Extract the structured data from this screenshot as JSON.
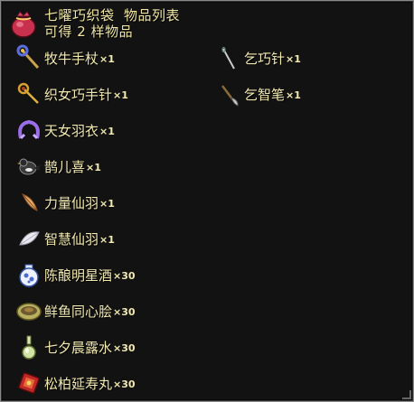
{
  "header": {
    "title": "七曜巧织袋  物品列表",
    "subtitle": "可得 2 样物品",
    "icon": "red-pouch-icon"
  },
  "left_items": [
    {
      "name": "牧牛手杖",
      "qty": "×1",
      "icon": "blue-staff-icon"
    },
    {
      "name": "织女巧手针",
      "qty": "×1",
      "icon": "golden-needle-icon"
    },
    {
      "name": "天女羽衣",
      "qty": "×1",
      "icon": "purple-ribbon-icon"
    },
    {
      "name": "鹊儿喜",
      "qty": "×1",
      "icon": "magpie-icon"
    },
    {
      "name": "力量仙羽",
      "qty": "×1",
      "icon": "orange-feather-icon"
    },
    {
      "name": "智慧仙羽",
      "qty": "×1",
      "icon": "white-feather-icon"
    },
    {
      "name": "陈酿明星酒",
      "qty": "×30",
      "icon": "porcelain-jar-icon"
    },
    {
      "name": "鲜鱼同心脍",
      "qty": "×30",
      "icon": "fish-dish-icon"
    },
    {
      "name": "七夕晨露水",
      "qty": "×30",
      "icon": "green-vase-icon"
    },
    {
      "name": "松柏延寿丸",
      "qty": "×30",
      "icon": "red-pill-box-icon"
    }
  ],
  "right_items": [
    {
      "name": "乞巧针",
      "qty": "×1",
      "icon": "needle-icon"
    },
    {
      "name": "乞智笔",
      "qty": "×1",
      "icon": "brush-pen-icon"
    }
  ]
}
